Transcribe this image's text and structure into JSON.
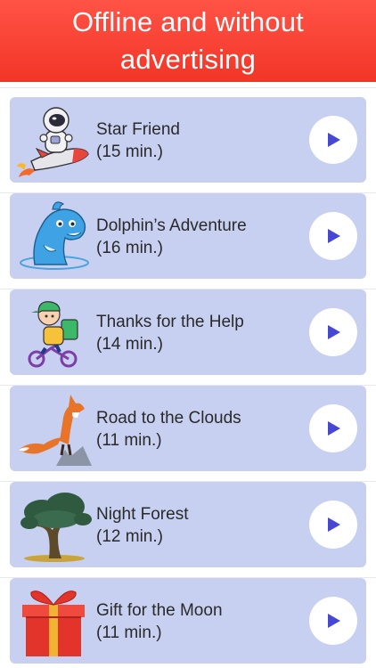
{
  "header": {
    "title": "Offline and without\nadvertising"
  },
  "colors": {
    "banner": "#f43b2c",
    "card": "#c7d0f1",
    "play_icon": "#4747d6"
  },
  "stories": [
    {
      "title": "Star Friend",
      "duration": "(15 min.)",
      "illustration": "astronaut-rocket-icon"
    },
    {
      "title": "Dolphin’s Adventure",
      "duration": "(16 min.)",
      "illustration": "dolphin-icon"
    },
    {
      "title": "Thanks for the Help",
      "duration": "(14 min.)",
      "illustration": "boy-bicycle-icon"
    },
    {
      "title": "Road to the Clouds",
      "duration": "(11 min.)",
      "illustration": "fox-icon"
    },
    {
      "title": "Night Forest",
      "duration": "(12 min.)",
      "illustration": "tree-icon"
    },
    {
      "title": "Gift for the Moon",
      "duration": "(11 min.)",
      "illustration": "gift-box-icon"
    }
  ]
}
